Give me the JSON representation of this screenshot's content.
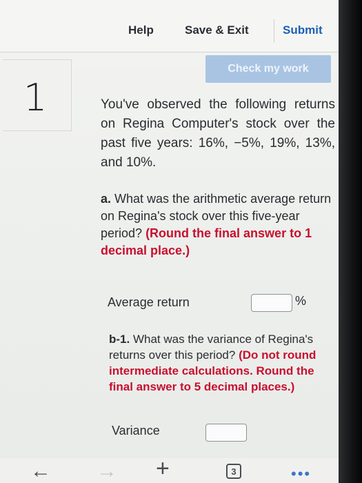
{
  "toolbar": {
    "help": "Help",
    "save_exit": "Save & Exit",
    "submit": "Submit",
    "check": "Check my work"
  },
  "question": {
    "number": "1",
    "intro": "You've observed the following returns on Regina Computer's stock over the past five years: 16%, −5%, 19%, 13%, and 10%.",
    "part_a": {
      "label": "a.",
      "text": "What was the arithmetic average return on Regina's stock over this five-year period?",
      "instruction": "(Round the final answer to 1 decimal place.)",
      "field_label": "Average return",
      "field_value": "",
      "unit": "%"
    },
    "part_b1": {
      "label": "b-1.",
      "text": "What was the variance of Regina's returns over this period?",
      "instruction": "(Do not round intermediate calculations. Round the final answer to 5 decimal places.)",
      "field_label": "Variance",
      "field_value": ""
    }
  },
  "browser": {
    "tab_count": "3",
    "icons": [
      "back-arrow-icon",
      "forward-arrow-icon",
      "plus-icon",
      "tabs-icon",
      "more-icon"
    ]
  },
  "colors": {
    "accent": "#1d5fb4",
    "check_button": "#a9c4e3",
    "instruction_red": "#c8102e"
  }
}
